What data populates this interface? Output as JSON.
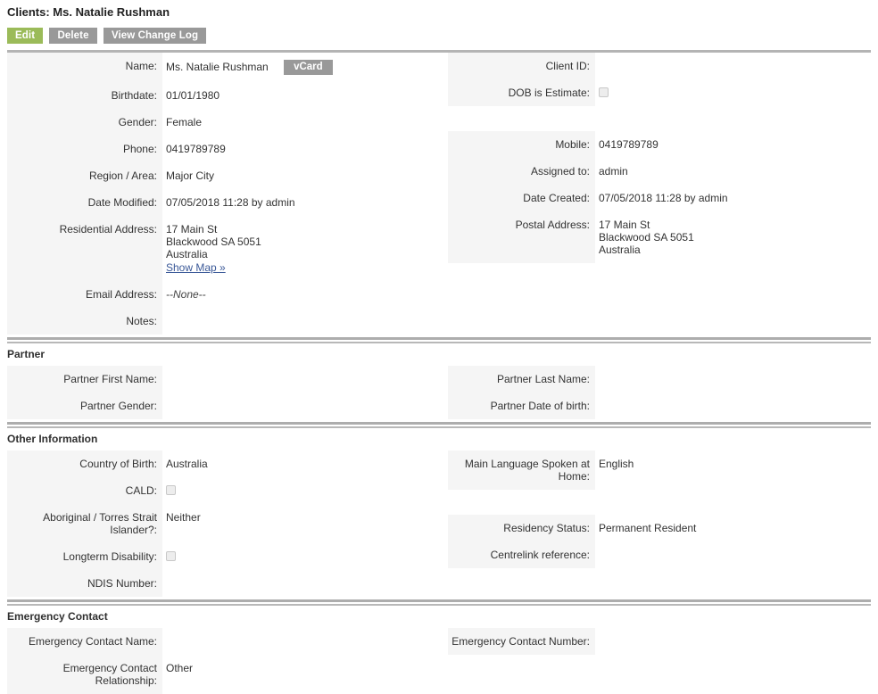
{
  "page": {
    "title": "Clients: Ms. Natalie Rushman"
  },
  "toolbar": {
    "edit_label": "Edit",
    "delete_label": "Delete",
    "changelog_label": "View Change Log"
  },
  "colors": {
    "primary_button": "#9bbb59",
    "secondary_button": "#999999",
    "label_background": "#f5f5f5",
    "link": "#3b5998"
  },
  "main_section": {
    "left": [
      {
        "label": "Name:",
        "value": "Ms. Natalie Rushman",
        "button": "vCard"
      },
      {
        "label": "Birthdate:",
        "value": "01/01/1980"
      },
      {
        "label": "Gender:",
        "value": "Female"
      },
      {
        "label": "Phone:",
        "value": "0419789789"
      },
      {
        "label": "Region / Area:",
        "value": "Major City"
      },
      {
        "label": "Date Modified:",
        "value": "07/05/2018 11:28 by admin"
      },
      {
        "label": "Residential Address:",
        "address": [
          "17 Main St",
          "Blackwood SA  5051",
          "Australia"
        ],
        "link": "Show Map »"
      },
      {
        "label": "Email Address:",
        "value": "--None--",
        "italic": true
      },
      {
        "label": "Notes:",
        "value": ""
      }
    ],
    "right": [
      {
        "label": "Client ID:",
        "value": ""
      },
      {
        "label": "DOB is Estimate:",
        "checkbox": true
      },
      {
        "label": "Mobile:",
        "value": "0419789789"
      },
      {
        "label": "Assigned to:",
        "value": "admin"
      },
      {
        "label": "Date Created:",
        "value": "07/05/2018 11:28 by admin"
      },
      {
        "label": "Postal Address:",
        "address": [
          "17 Main St",
          "Blackwood SA  5051",
          "Australia"
        ]
      }
    ]
  },
  "partner_section": {
    "heading": "Partner",
    "left": [
      {
        "label": "Partner First Name:",
        "value": ""
      },
      {
        "label": "Partner Gender:",
        "value": ""
      }
    ],
    "right": [
      {
        "label": "Partner Last Name:",
        "value": ""
      },
      {
        "label": "Partner Date of birth:",
        "value": ""
      }
    ]
  },
  "other_section": {
    "heading": "Other Information",
    "left": [
      {
        "label": "Country of Birth:",
        "value": "Australia"
      },
      {
        "label": "CALD:",
        "checkbox": true
      },
      {
        "label": "Aboriginal / Torres Strait Islander?:",
        "value": "Neither"
      },
      {
        "label": "Longterm Disability:",
        "checkbox": true
      },
      {
        "label": "NDIS Number:",
        "value": ""
      }
    ],
    "right": [
      {
        "label": "Main Language Spoken at Home:",
        "value": "English"
      },
      {
        "label": "Residency Status:",
        "value": "Permanent Resident"
      },
      {
        "label": "Centrelink reference:",
        "value": ""
      }
    ]
  },
  "emergency_section": {
    "heading": "Emergency Contact",
    "left": [
      {
        "label": "Emergency Contact Name:",
        "value": ""
      },
      {
        "label": "Emergency Contact Relationship:",
        "value": "Other"
      }
    ],
    "right": [
      {
        "label": "Emergency Contact Number:",
        "value": ""
      }
    ]
  }
}
